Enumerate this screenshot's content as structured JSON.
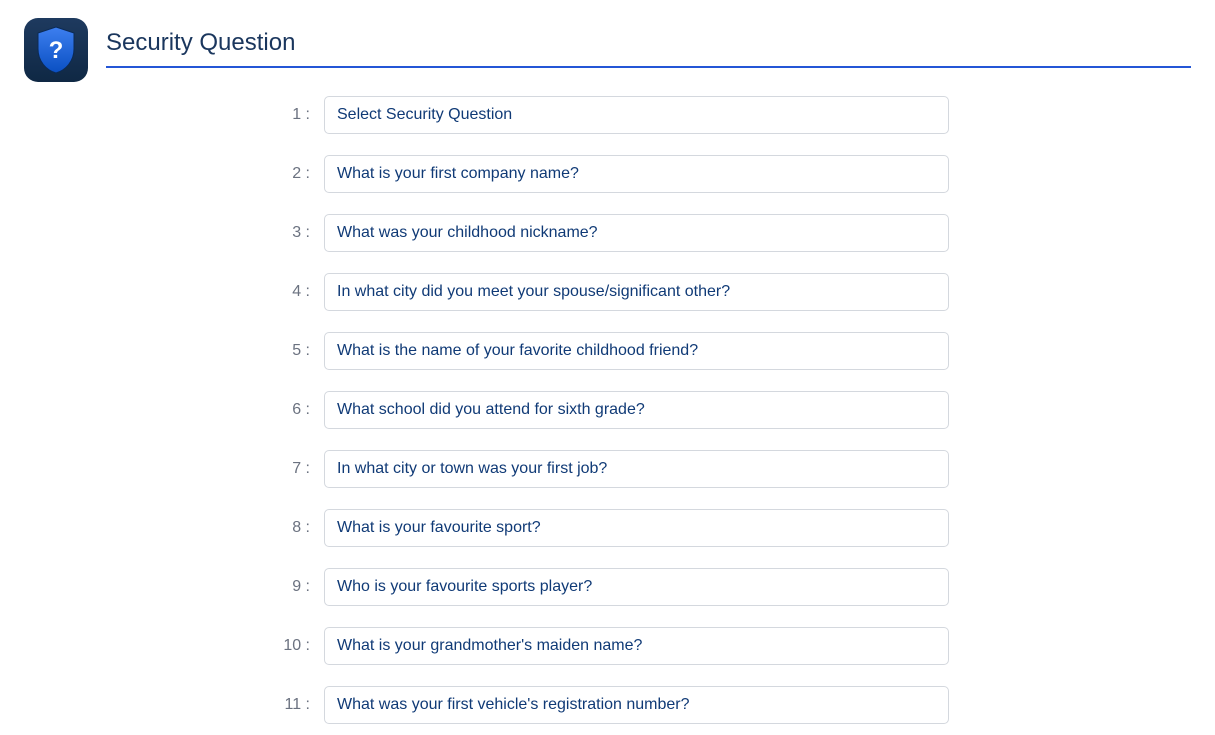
{
  "header": {
    "title": "Security Question"
  },
  "questions": [
    {
      "index": "1 :",
      "text": "Select Security Question"
    },
    {
      "index": "2 :",
      "text": "What is your first company name?"
    },
    {
      "index": "3 :",
      "text": "What was your childhood nickname?"
    },
    {
      "index": "4 :",
      "text": "In what city did you meet your spouse/significant other?"
    },
    {
      "index": "5 :",
      "text": "What is the name of your favorite childhood friend?"
    },
    {
      "index": "6 :",
      "text": "What school did you attend for sixth grade?"
    },
    {
      "index": "7 :",
      "text": "In what city or town was your first job?"
    },
    {
      "index": "8 :",
      "text": "What is your favourite sport?"
    },
    {
      "index": "9 :",
      "text": "Who is your favourite sports player?"
    },
    {
      "index": "10 :",
      "text": "What is your grandmother's maiden name?"
    },
    {
      "index": "11 :",
      "text": "What was your first vehicle's registration number?"
    }
  ]
}
